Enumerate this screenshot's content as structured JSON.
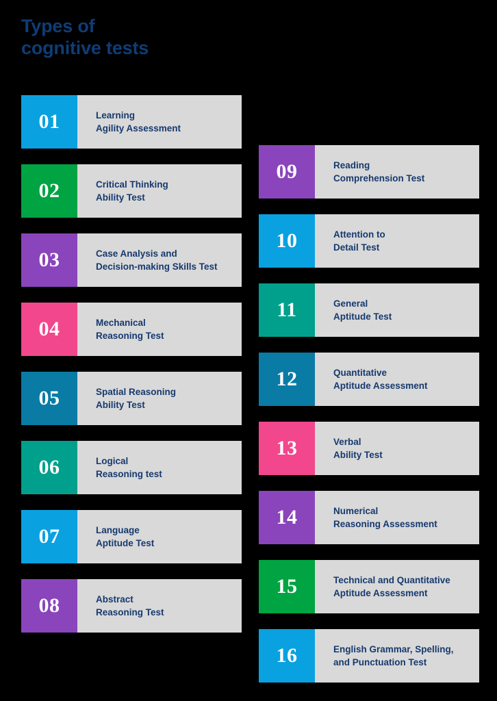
{
  "title": "Types of\ncognitive tests",
  "colors": {
    "background": "#000000",
    "title_text": "#0e3d77",
    "card_body_bg": "#d9d9d9",
    "card_label_text": "#16396e",
    "number_text": "#ffffff",
    "azure": "#0aa1e0",
    "green": "#00a443",
    "purple": "#8a45bc",
    "pink": "#f2478c",
    "dark_blue": "#0a7ba5",
    "teal": "#00a08c"
  },
  "columns": {
    "left": {
      "cards": [
        {
          "number": "01",
          "label": "Learning\nAgility Assessment",
          "color": "#0aa1e0"
        },
        {
          "number": "02",
          "label": "Critical Thinking\nAbility Test",
          "color": "#00a443"
        },
        {
          "number": "03",
          "label": "Case Analysis and\nDecision-making Skills Test",
          "color": "#8a45bc"
        },
        {
          "number": "04",
          "label": "Mechanical\nReasoning Test",
          "color": "#f2478c"
        },
        {
          "number": "05",
          "label": "Spatial Reasoning\nAbility Test",
          "color": "#0a7ba5"
        },
        {
          "number": "06",
          "label": "Logical\nReasoning test",
          "color": "#00a08c"
        },
        {
          "number": "07",
          "label": "Language\nAptitude Test",
          "color": "#0aa1e0"
        },
        {
          "number": "08",
          "label": "Abstract\nReasoning Test",
          "color": "#8a45bc"
        }
      ]
    },
    "right": {
      "cards": [
        {
          "number": "09",
          "label": "Reading\nComprehension Test",
          "color": "#8a45bc"
        },
        {
          "number": "10",
          "label": "Attention to\nDetail Test",
          "color": "#0aa1e0"
        },
        {
          "number": "11",
          "label": "General\nAptitude Test",
          "color": "#00a08c"
        },
        {
          "number": "12",
          "label": "Quantitative\nAptitude Assessment",
          "color": "#0a7ba5"
        },
        {
          "number": "13",
          "label": "Verbal\nAbility Test",
          "color": "#f2478c"
        },
        {
          "number": "14",
          "label": "Numerical\nReasoning Assessment",
          "color": "#8a45bc"
        },
        {
          "number": "15",
          "label": "Technical and Quantitative\nAptitude Assessment",
          "color": "#00a443"
        },
        {
          "number": "16",
          "label": "English Grammar, Spelling,\nand Punctuation Test",
          "color": "#0aa1e0"
        }
      ]
    }
  }
}
